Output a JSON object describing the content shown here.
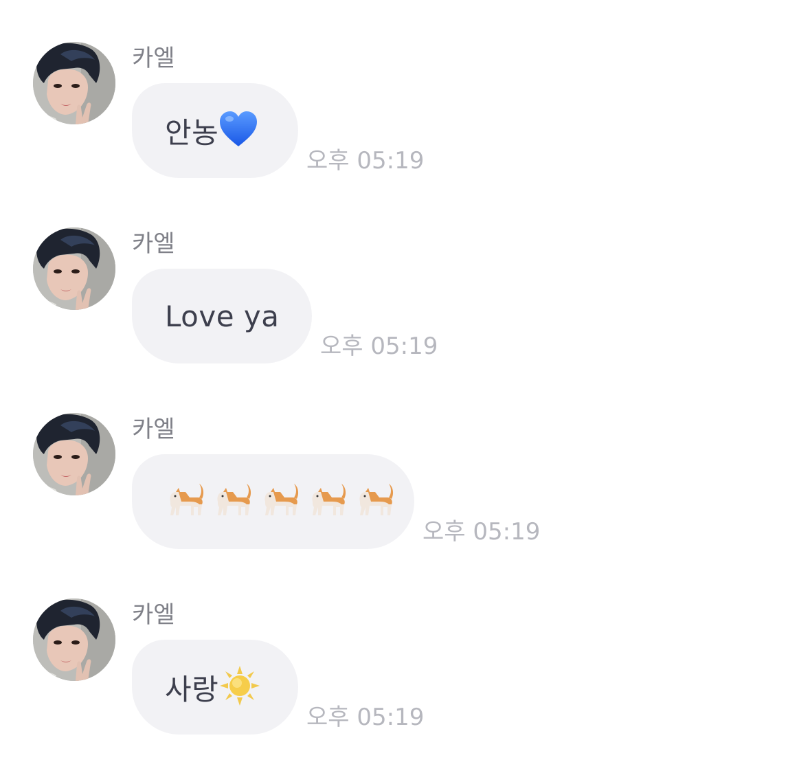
{
  "chat": {
    "messages": [
      {
        "sender": "카엘",
        "text": "안농",
        "emoji": "blue-heart-icon",
        "time": "오후 05:19"
      },
      {
        "sender": "카엘",
        "text": "Love ya",
        "emoji": "",
        "time": "오후 05:19"
      },
      {
        "sender": "카엘",
        "text": "",
        "emoji": "cat-icon",
        "emoji_count": 5,
        "time": "오후 05:19"
      },
      {
        "sender": "카엘",
        "text": "사랑",
        "emoji": "sun-icon",
        "time": "오후 05:19"
      }
    ]
  },
  "colors": {
    "bubble": "#f2f2f5",
    "text": "#3d3f4d",
    "sender": "#7f8088",
    "time": "#b6b7be",
    "heart": "#2f73ff",
    "sun": "#f6c944"
  }
}
